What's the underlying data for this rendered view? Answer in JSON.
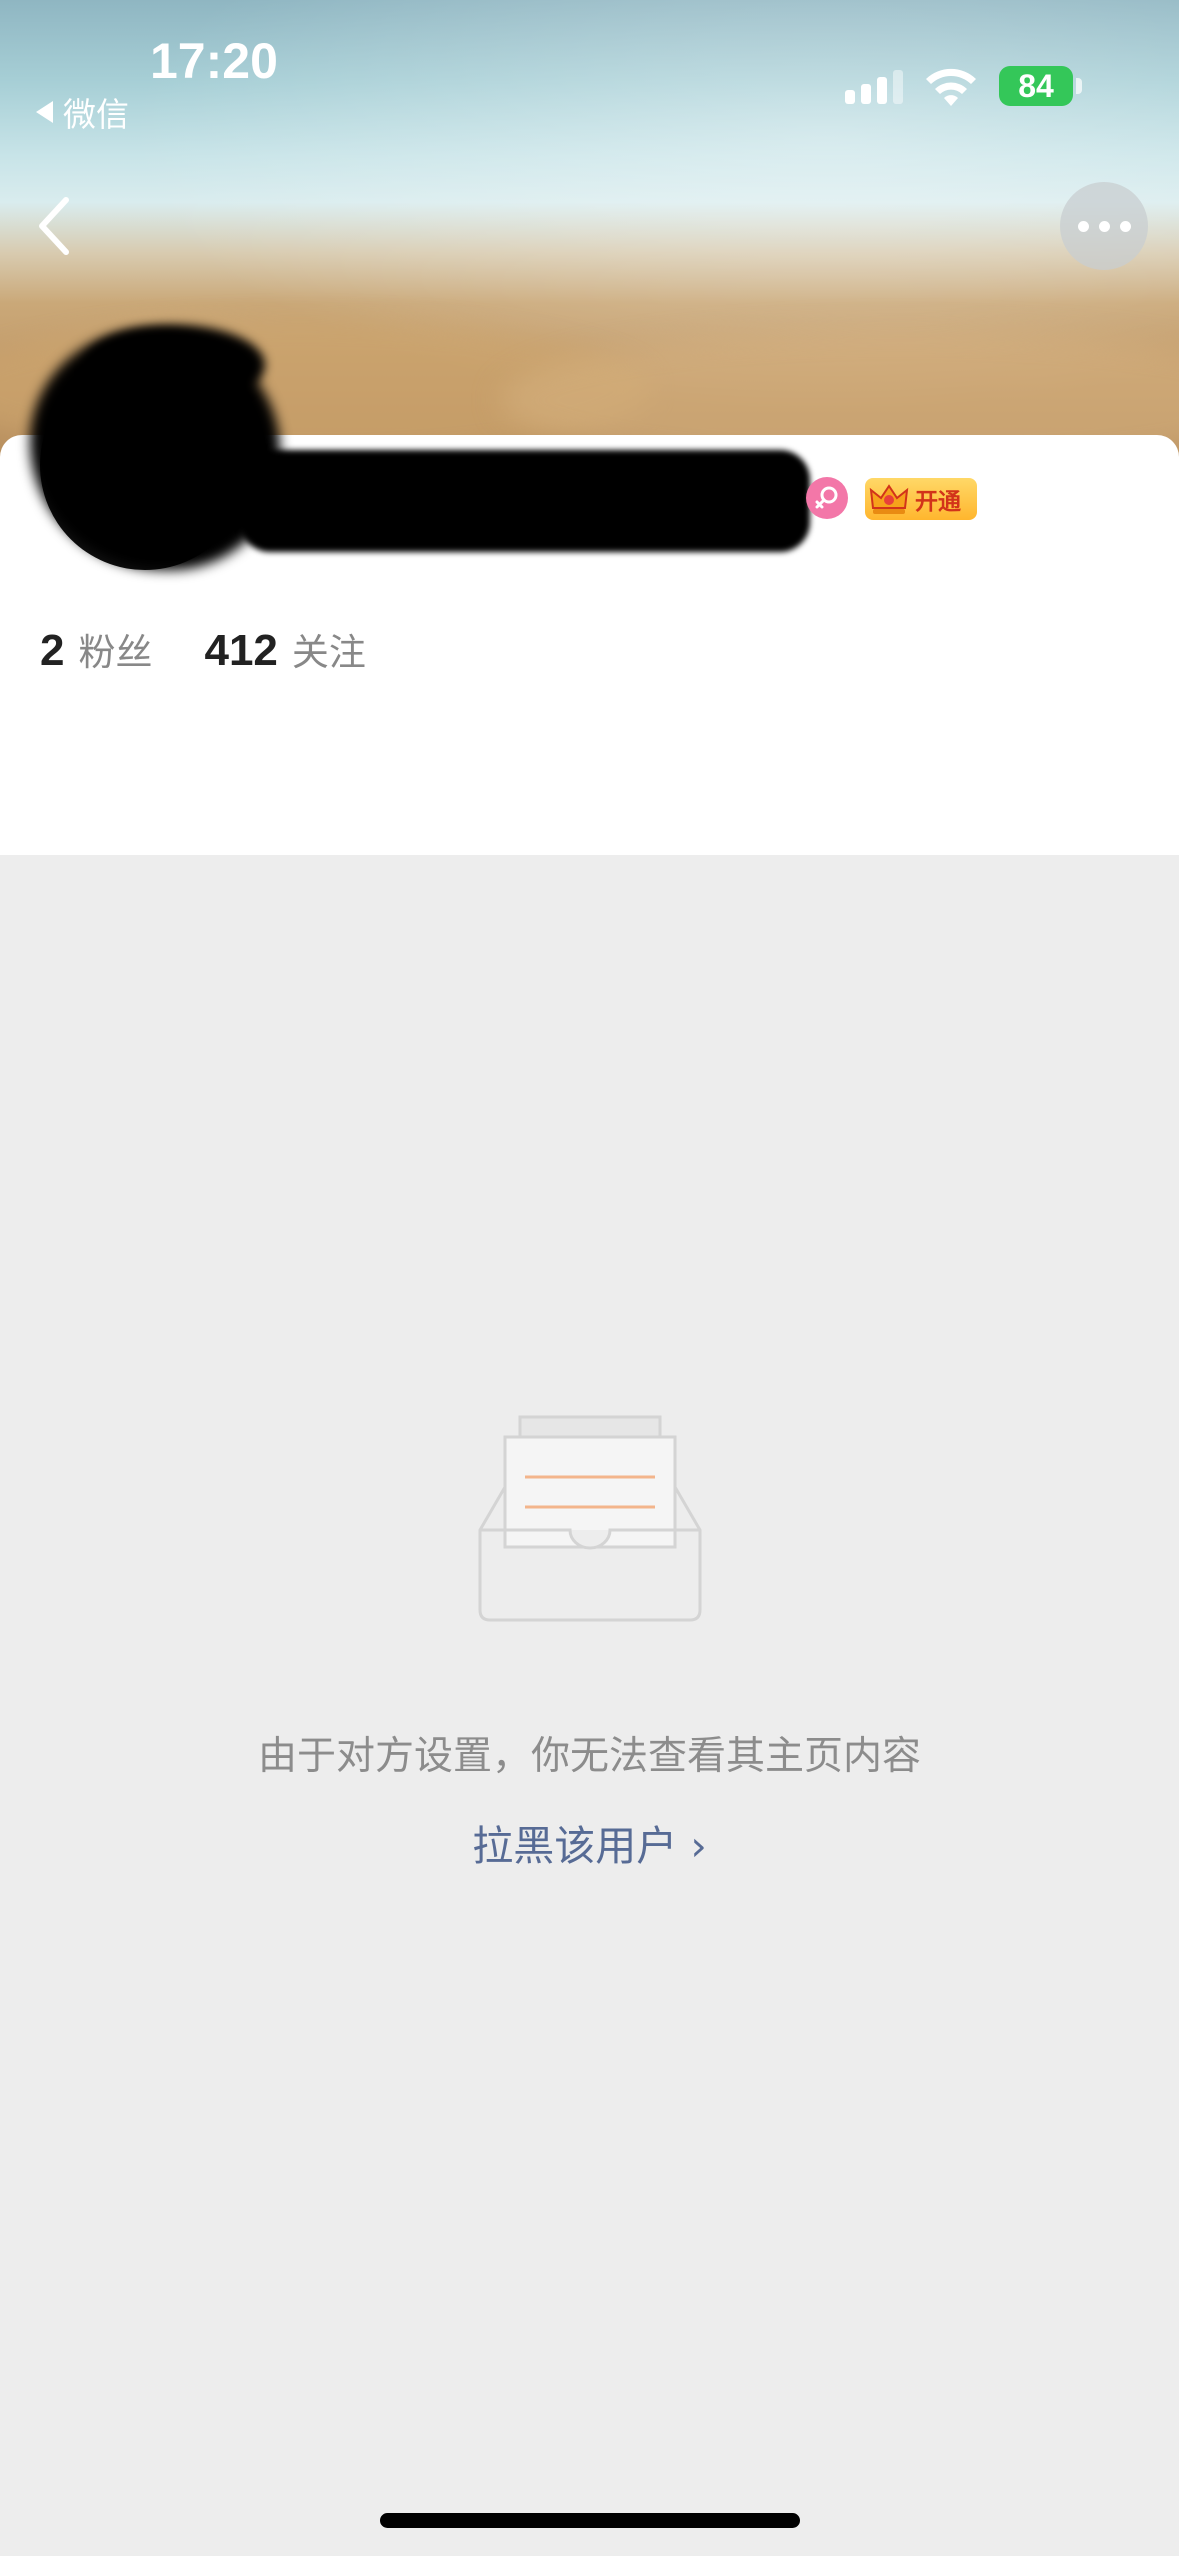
{
  "status_bar": {
    "time": "17:20",
    "back_app_label": "微信",
    "battery_level": "84"
  },
  "header": {
    "back_icon": "chevron-left-icon",
    "more_icon": "more-dots-icon"
  },
  "profile": {
    "badges": {
      "gender_icon": "female-icon",
      "vip_label": "开通"
    },
    "stats": [
      {
        "value": "2",
        "label": "粉丝"
      },
      {
        "value": "412",
        "label": "关注"
      }
    ]
  },
  "empty_state": {
    "illustration": "empty-box-icon",
    "message": "由于对方设置，你无法查看其主页内容",
    "action_label": "拉黑该用户 ›"
  },
  "colors": {
    "background": "#ededed",
    "link": "#576b95",
    "battery": "#34c759",
    "gender": "#f377a8"
  }
}
